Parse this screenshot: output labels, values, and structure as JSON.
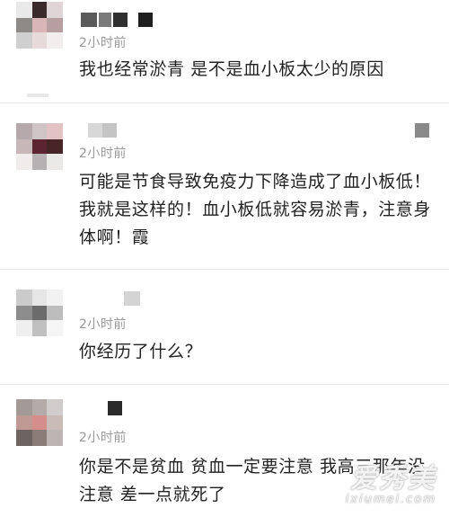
{
  "comments": [
    {
      "time": "2小时前",
      "text": "我也经常淤青 是不是血小板太少的原因"
    },
    {
      "time": "2小时前",
      "text": "可能是节食导致免疫力下降造成了血小板低！我就是这样的！血小板低就容易淤青，注意身体啊！霞"
    },
    {
      "time": "2小时前",
      "text": "你经历了什么？"
    },
    {
      "time": "2小时前",
      "text": "你是不是贫血 贫血一定要注意 我高三那年没注意 差一点就死了"
    }
  ],
  "watermark": {
    "main": "爱秀美",
    "sub": "ixiumei.com"
  }
}
